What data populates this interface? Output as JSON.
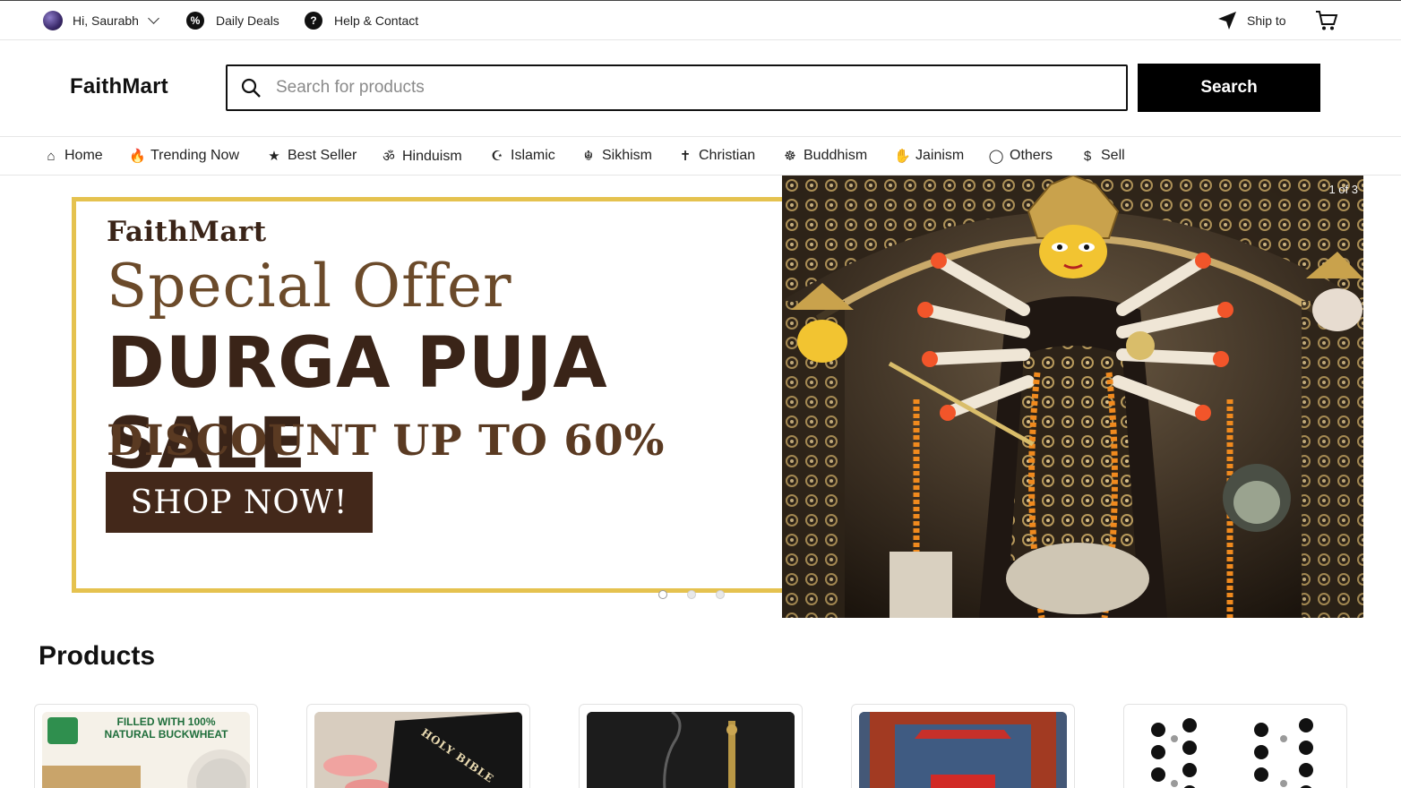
{
  "topbar": {
    "greeting": "Hi, Saurabh",
    "daily_deals": "Daily Deals",
    "help_contact": "Help & Contact",
    "ship_to": "Ship to"
  },
  "header": {
    "logo": "FaithMart",
    "search_placeholder": "Search for products",
    "search_button": "Search"
  },
  "categories": [
    {
      "label": "Home",
      "icon": "home-icon"
    },
    {
      "label": "Trending Now",
      "icon": "flame-icon"
    },
    {
      "label": "Best Seller",
      "icon": "star-icon"
    },
    {
      "label": "Hinduism",
      "icon": "om-icon"
    },
    {
      "label": "Islamic",
      "icon": "crescent-icon"
    },
    {
      "label": "Sikhism",
      "icon": "khanda-icon"
    },
    {
      "label": "Christian",
      "icon": "cross-icon"
    },
    {
      "label": "Buddhism",
      "icon": "dharma-wheel-icon"
    },
    {
      "label": "Jainism",
      "icon": "jain-hand-icon"
    },
    {
      "label": "Others",
      "icon": "circle-icon"
    },
    {
      "label": "Sell",
      "icon": "dollar-icon"
    }
  ],
  "banner": {
    "brand": "FaithMart",
    "headline": "Special Offer",
    "sale": "DURGA PUJA SALE",
    "discount": "DISCOUNT UP TO 60%",
    "cta": "SHOP NOW!",
    "counter": "1 of 3",
    "slide_count": 3,
    "active_slide": 1
  },
  "products": {
    "title": "Products",
    "items": [
      {
        "thumb_text_line1": "FILLED WITH 100%",
        "thumb_text_line2": "NATURAL BUCKWHEAT"
      },
      {
        "thumb_text": "HOLY BIBLE"
      },
      {
        "thumb_text": ""
      },
      {
        "thumb_text": ""
      },
      {
        "thumb_text": ""
      }
    ]
  },
  "colors": {
    "accent_gold": "#e5c24f",
    "brown_dark": "#3a2418",
    "brown_button": "#43281a",
    "search_button": "#000000"
  }
}
